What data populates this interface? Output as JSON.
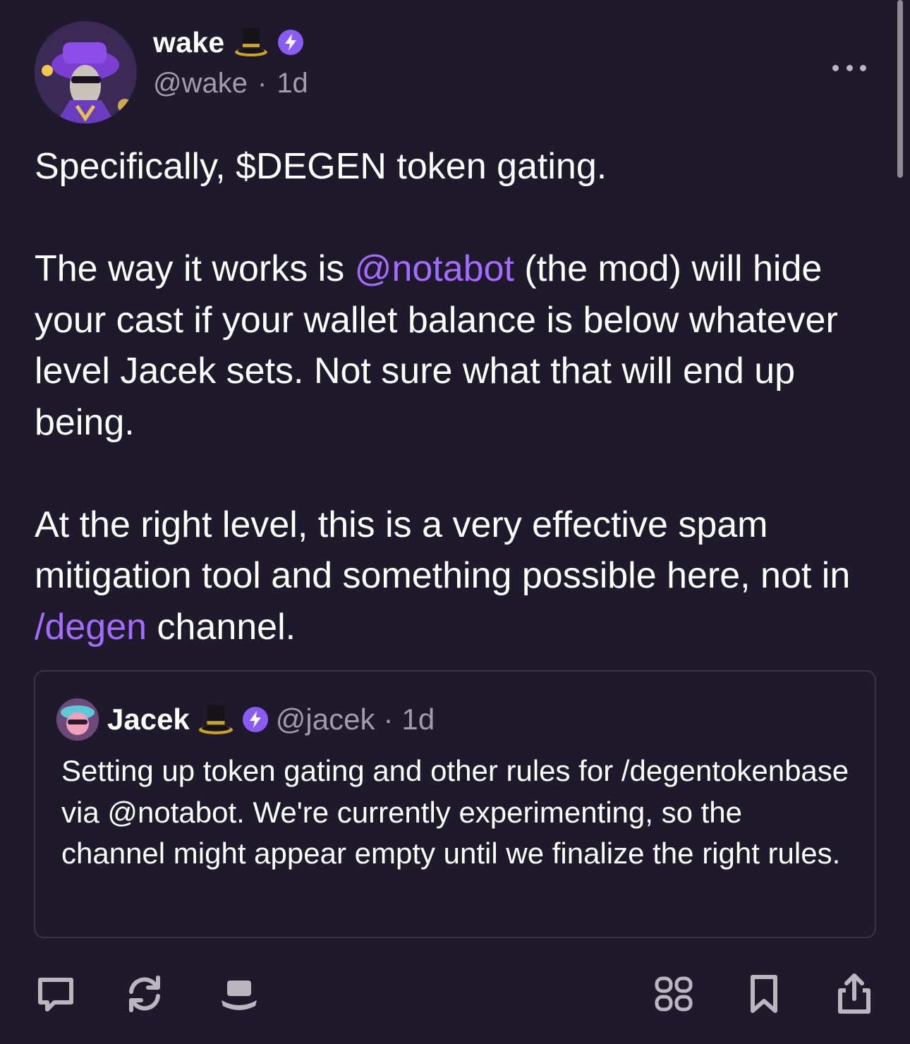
{
  "post": {
    "author": {
      "display_name": "wake",
      "hat_icon": "top-hat-emoji",
      "badge_icon": "lightning-badge-icon",
      "handle": "@wake",
      "separator": "·",
      "time": "1d"
    },
    "body": {
      "paragraph1": "Specifically, $DEGEN token gating.",
      "paragraph2_part1": "The way it works is ",
      "paragraph2_mention": "@notabot",
      "paragraph2_part2": " (the mod) will hide your cast if your wallet balance is below whatever level Jacek sets. Not sure what that will end up being.",
      "paragraph3_part1": "At the right level, this is a very effective spam mitigation tool and something possible here, not in ",
      "paragraph3_channel": "/degen",
      "paragraph3_part2": " channel."
    },
    "quote": {
      "display_name": "Jacek",
      "hat_icon": "top-hat-emoji",
      "badge_icon": "lightning-badge-icon",
      "handle": "@jacek",
      "separator": "·",
      "time": "1d",
      "text": "Setting up token gating and other rules for /degentokenbase via @notabot. We're currently experimenting, so the channel might appear empty until we finalize the right rules."
    }
  },
  "actions": [
    {
      "name": "reply",
      "icon": "comment-icon"
    },
    {
      "name": "recast",
      "icon": "recast-icon"
    },
    {
      "name": "tip",
      "icon": "degen-hat-icon"
    },
    {
      "name": "apps",
      "icon": "grid-icon"
    },
    {
      "name": "bookmark",
      "icon": "bookmark-icon"
    },
    {
      "name": "share",
      "icon": "share-icon"
    }
  ],
  "colors": {
    "background": "#1f1a2b",
    "text": "#ffffff",
    "muted": "#a09cab",
    "accent": "#a36bff",
    "badge": "#8a5cf5",
    "card_border": "#3a3447"
  }
}
